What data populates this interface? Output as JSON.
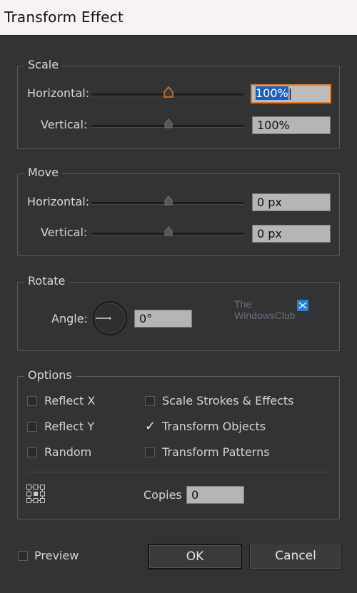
{
  "window": {
    "title": "Transform Effect"
  },
  "scale": {
    "legend": "Scale",
    "horizontal_label": "Horizontal:",
    "horizontal_value": "100%",
    "vertical_label": "Vertical:",
    "vertical_value": "100%"
  },
  "move": {
    "legend": "Move",
    "horizontal_label": "Horizontal:",
    "horizontal_value": "0 px",
    "vertical_label": "Vertical:",
    "vertical_value": "0 px"
  },
  "rotate": {
    "legend": "Rotate",
    "angle_label": "Angle:",
    "angle_value": "0°"
  },
  "watermark": {
    "line1": "The",
    "line2": "WindowsClub"
  },
  "options": {
    "legend": "Options",
    "reflect_x": {
      "label": "Reflect X",
      "checked": false
    },
    "reflect_y": {
      "label": "Reflect Y",
      "checked": false
    },
    "random": {
      "label": "Random",
      "checked": false
    },
    "scale_strokes": {
      "label": "Scale Strokes & Effects",
      "checked": false
    },
    "transform_objects": {
      "label": "Transform Objects",
      "checked": true
    },
    "transform_patterns": {
      "label": "Transform Patterns",
      "checked": false
    },
    "copies_label": "Copies",
    "copies_value": "0"
  },
  "footer": {
    "preview_label": "Preview",
    "preview_checked": false,
    "ok_label": "OK",
    "cancel_label": "Cancel"
  },
  "colors": {
    "dialog_bg": "#333333",
    "titlebar_bg": "#f6f3f2",
    "focus_accent": "#e07a2c",
    "selection": "#1d5fbf"
  }
}
